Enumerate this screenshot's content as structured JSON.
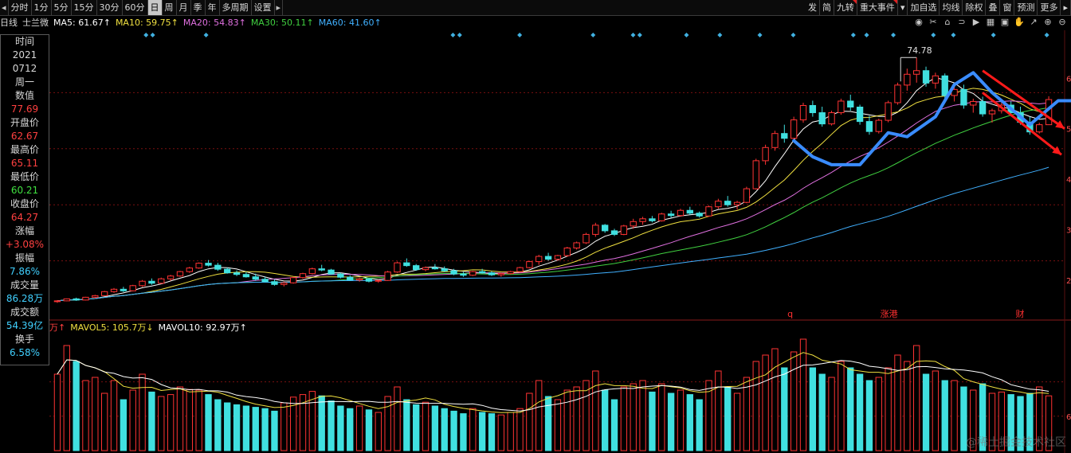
{
  "toolbar": {
    "left": [
      {
        "label": "分时",
        "name": "period-intraday",
        "active": false
      },
      {
        "label": "1分",
        "name": "period-1min",
        "active": false
      },
      {
        "label": "5分",
        "name": "period-5min",
        "active": false
      },
      {
        "label": "15分",
        "name": "period-15min",
        "active": false
      },
      {
        "label": "30分",
        "name": "period-30min",
        "active": false
      },
      {
        "label": "60分",
        "name": "period-60min",
        "active": false
      },
      {
        "label": "日",
        "name": "period-day",
        "active": true
      },
      {
        "label": "周",
        "name": "period-week",
        "active": false
      },
      {
        "label": "月",
        "name": "period-month",
        "active": false
      },
      {
        "label": "季",
        "name": "period-quarter",
        "active": false
      },
      {
        "label": "年",
        "name": "period-year",
        "active": false
      },
      {
        "label": "多周期",
        "name": "period-multi",
        "active": false
      },
      {
        "label": "设置",
        "name": "settings",
        "active": false
      }
    ],
    "right": [
      {
        "label": "发",
        "name": "btn-fa",
        "mark": false
      },
      {
        "label": "简",
        "name": "btn-jian",
        "mark": false
      },
      {
        "label": "九转",
        "name": "btn-jiuzhuan",
        "mark": true
      },
      {
        "label": "重大事件",
        "name": "btn-events",
        "mark": true
      },
      {
        "label": "▾",
        "name": "btn-events-dropdown",
        "mark": false
      },
      {
        "label": "加自选",
        "name": "btn-add-watchlist",
        "mark": false
      },
      {
        "label": "均线",
        "name": "btn-ma",
        "mark": false
      },
      {
        "label": "除权",
        "name": "btn-exright",
        "mark": false
      },
      {
        "label": "叠",
        "name": "btn-overlay",
        "mark": false
      },
      {
        "label": "窗",
        "name": "btn-window",
        "mark": false
      },
      {
        "label": "预测",
        "name": "btn-forecast",
        "mark": false
      },
      {
        "label": "更多",
        "name": "btn-more",
        "mark": false
      },
      {
        "label": "▸",
        "name": "btn-next",
        "mark": false
      }
    ],
    "left_arrow": "◂",
    "right_arrow": "▸"
  },
  "ma_legend": {
    "period": "日线",
    "name": "士兰微",
    "items": [
      {
        "label": "MA5: 61.67↑",
        "color": "#ffffff"
      },
      {
        "label": "MA10: 59.75↑",
        "color": "#f0e040"
      },
      {
        "label": "MA20: 54.83↑",
        "color": "#e070e0"
      },
      {
        "label": "MA30: 50.11↑",
        "color": "#40d040"
      },
      {
        "label": "MA60: 41.60↑",
        "color": "#40b0ff"
      }
    ]
  },
  "info_panel": {
    "rows": [
      {
        "label": "时间",
        "value": "2021",
        "color": "#d8d8d8"
      },
      {
        "label": "",
        "value": "0712",
        "color": "#d8d8d8"
      },
      {
        "label": "周一",
        "value": "",
        "color": "#d8d8d8"
      },
      {
        "label": "数值",
        "value": "77.69",
        "color": "#ff4040"
      },
      {
        "label": "开盘价",
        "value": "62.67",
        "color": "#ff4040"
      },
      {
        "label": "最高价",
        "value": "65.11",
        "color": "#ff4040"
      },
      {
        "label": "最低价",
        "value": "60.21",
        "color": "#40e040"
      },
      {
        "label": "收盘价",
        "value": "64.27",
        "color": "#ff4040"
      },
      {
        "label": "涨幅",
        "value": "+3.08%",
        "color": "#ff4040"
      },
      {
        "label": "振幅",
        "value": "7.86%",
        "color": "#40d0ff"
      },
      {
        "label": "成交量",
        "value": "86.28万",
        "color": "#40d0ff"
      },
      {
        "label": "成交额",
        "value": "54.39亿",
        "color": "#40d0ff"
      },
      {
        "label": "换手",
        "value": "6.58%",
        "color": "#40d0ff"
      }
    ]
  },
  "volume_legend": {
    "items": [
      {
        "label": "万↑",
        "color": "#ff4040"
      },
      {
        "label": "MAVOL5: 105.7万↓",
        "color": "#f0e040"
      },
      {
        "label": "MAVOL10: 92.97万↑",
        "color": "#ffffff"
      }
    ]
  },
  "annotations": {
    "high_label": "74.78",
    "event_q": "q",
    "event_2": "涨港",
    "event_3": "财"
  },
  "axis_ticks": [
    "6",
    "5",
    "4",
    "3",
    "2"
  ],
  "vol_axis_ticks": [
    "6"
  ],
  "icons": [
    "eye-icon",
    "scissors-icon",
    "brush-icon",
    "magnet-icon",
    "play-icon",
    "grid-icon",
    "fullscreen-icon",
    "hand-icon",
    "arrow-icon",
    "zoom-in-icon",
    "zoom-out-icon"
  ],
  "icon_glyphs": [
    "◉",
    "✂",
    "⌂",
    "⊃",
    "▶",
    "▦",
    "▣",
    "✋",
    "↗",
    "⊕",
    "⊖"
  ],
  "watermark": "@稀土掘金技术社区",
  "colors": {
    "up": "#ff3333",
    "down": "#40e0e0",
    "grid": "#7a1010",
    "blue_trend": "#3a8cff",
    "red_arrow": "#ff1a1a"
  },
  "chart_data": {
    "type": "candlestick",
    "title": "士兰微 日线",
    "price_ylim": [
      10,
      80
    ],
    "candles": [
      [
        13.8,
        14.2,
        13.5,
        14.0
      ],
      [
        14.0,
        14.6,
        13.9,
        14.5
      ],
      [
        14.5,
        14.8,
        14.0,
        14.2
      ],
      [
        14.2,
        15.0,
        14.1,
        14.9
      ],
      [
        14.9,
        15.5,
        14.6,
        15.3
      ],
      [
        15.3,
        16.5,
        15.2,
        16.3
      ],
      [
        16.3,
        17.2,
        16.0,
        16.9
      ],
      [
        16.9,
        17.5,
        16.2,
        16.5
      ],
      [
        16.5,
        18.0,
        16.4,
        17.8
      ],
      [
        17.8,
        19.2,
        17.5,
        18.9
      ],
      [
        18.9,
        19.6,
        18.0,
        18.4
      ],
      [
        18.4,
        19.8,
        18.2,
        19.5
      ],
      [
        19.5,
        20.5,
        19.0,
        20.2
      ],
      [
        20.2,
        21.5,
        20.0,
        21.3
      ],
      [
        21.3,
        22.5,
        21.0,
        22.2
      ],
      [
        22.2,
        23.6,
        22.0,
        23.4
      ],
      [
        23.4,
        24.2,
        22.6,
        22.9
      ],
      [
        22.9,
        23.5,
        21.5,
        21.9
      ],
      [
        21.9,
        22.3,
        20.8,
        21.0
      ],
      [
        21.0,
        21.6,
        20.2,
        20.6
      ],
      [
        20.6,
        21.2,
        19.8,
        20.0
      ],
      [
        20.0,
        20.8,
        19.0,
        19.4
      ],
      [
        19.4,
        20.0,
        18.6,
        18.8
      ],
      [
        18.8,
        19.4,
        17.8,
        18.1
      ],
      [
        18.1,
        18.8,
        17.6,
        18.5
      ],
      [
        18.5,
        20.0,
        18.3,
        19.8
      ],
      [
        19.8,
        21.0,
        19.5,
        20.8
      ],
      [
        20.8,
        22.3,
        20.6,
        22.0
      ],
      [
        22.0,
        23.0,
        21.4,
        21.7
      ],
      [
        21.7,
        22.0,
        20.5,
        20.7
      ],
      [
        20.7,
        21.0,
        19.6,
        19.9
      ],
      [
        19.9,
        20.4,
        19.0,
        19.2
      ],
      [
        19.2,
        19.8,
        18.8,
        19.5
      ],
      [
        19.5,
        19.7,
        18.6,
        18.9
      ],
      [
        18.9,
        19.3,
        18.5,
        19.1
      ],
      [
        19.1,
        21.5,
        19.0,
        21.2
      ],
      [
        21.2,
        23.8,
        21.0,
        23.5
      ],
      [
        23.5,
        24.6,
        22.5,
        22.8
      ],
      [
        22.8,
        23.2,
        21.5,
        21.8
      ],
      [
        21.8,
        22.6,
        21.4,
        22.3
      ],
      [
        22.3,
        23.2,
        21.8,
        22.0
      ],
      [
        22.0,
        22.6,
        21.2,
        21.5
      ],
      [
        21.5,
        22.0,
        20.4,
        20.7
      ],
      [
        20.7,
        21.2,
        20.0,
        20.4
      ],
      [
        20.4,
        21.5,
        20.2,
        21.3
      ],
      [
        21.3,
        22.0,
        20.8,
        21.0
      ],
      [
        21.0,
        21.4,
        20.2,
        20.5
      ],
      [
        20.5,
        21.0,
        20.0,
        20.8
      ],
      [
        20.8,
        21.5,
        20.6,
        21.3
      ],
      [
        21.3,
        22.5,
        21.1,
        22.3
      ],
      [
        22.3,
        24.0,
        22.1,
        23.8
      ],
      [
        23.8,
        25.5,
        23.0,
        25.1
      ],
      [
        25.1,
        26.0,
        24.0,
        24.4
      ],
      [
        24.4,
        25.5,
        24.0,
        25.3
      ],
      [
        25.3,
        27.5,
        25.0,
        27.2
      ],
      [
        27.2,
        28.8,
        26.8,
        28.5
      ],
      [
        28.5,
        31.0,
        28.2,
        30.6
      ],
      [
        30.6,
        33.5,
        30.0,
        32.9
      ],
      [
        32.9,
        33.2,
        31.0,
        31.5
      ],
      [
        31.5,
        32.0,
        30.2,
        30.6
      ],
      [
        30.6,
        33.0,
        30.4,
        32.7
      ],
      [
        32.7,
        34.5,
        32.0,
        33.8
      ],
      [
        33.8,
        35.0,
        33.0,
        34.5
      ],
      [
        34.5,
        35.2,
        33.6,
        34.0
      ],
      [
        34.0,
        36.0,
        33.8,
        35.7
      ],
      [
        35.7,
        36.5,
        34.8,
        35.3
      ],
      [
        35.3,
        37.0,
        35.0,
        36.6
      ],
      [
        36.6,
        37.5,
        35.5,
        35.9
      ],
      [
        35.9,
        36.3,
        34.8,
        35.2
      ],
      [
        35.2,
        37.8,
        35.0,
        37.5
      ],
      [
        37.5,
        39.5,
        37.0,
        38.9
      ],
      [
        38.9,
        40.2,
        37.5,
        38.0
      ],
      [
        38.0,
        39.0,
        36.8,
        38.6
      ],
      [
        38.6,
        42.5,
        38.4,
        42.0
      ],
      [
        42.0,
        49.5,
        41.8,
        49.0
      ],
      [
        49.0,
        53.0,
        48.0,
        52.3
      ],
      [
        52.3,
        56.5,
        51.5,
        55.8
      ],
      [
        55.8,
        58.0,
        53.5,
        54.6
      ],
      [
        54.6,
        60.0,
        54.2,
        59.2
      ],
      [
        59.2,
        63.5,
        58.5,
        62.8
      ],
      [
        62.8,
        64.0,
        60.0,
        61.0
      ],
      [
        61.0,
        62.5,
        57.5,
        58.2
      ],
      [
        58.2,
        61.5,
        57.8,
        61.0
      ],
      [
        61.0,
        64.5,
        60.5,
        63.9
      ],
      [
        63.9,
        65.5,
        61.5,
        62.4
      ],
      [
        62.4,
        63.0,
        58.0,
        58.8
      ],
      [
        58.8,
        60.2,
        55.5,
        56.3
      ],
      [
        56.3,
        59.5,
        55.8,
        59.1
      ],
      [
        59.1,
        64.0,
        58.6,
        63.5
      ],
      [
        63.5,
        68.5,
        63.0,
        67.9
      ],
      [
        67.9,
        72.0,
        66.5,
        70.6
      ],
      [
        70.6,
        74.78,
        68.5,
        71.5
      ],
      [
        71.5,
        72.5,
        67.5,
        68.4
      ],
      [
        68.4,
        71.0,
        67.0,
        70.2
      ],
      [
        70.2,
        70.8,
        64.5,
        65.3
      ],
      [
        65.3,
        67.5,
        63.8,
        66.8
      ],
      [
        66.8,
        68.0,
        62.0,
        62.9
      ],
      [
        62.9,
        64.5,
        61.0,
        63.8
      ],
      [
        63.8,
        65.0,
        60.0,
        60.7
      ],
      [
        60.7,
        62.0,
        58.5,
        61.5
      ],
      [
        61.5,
        63.5,
        60.8,
        62.9
      ],
      [
        62.9,
        63.8,
        60.5,
        61.0
      ],
      [
        61.0,
        62.5,
        58.0,
        58.6
      ],
      [
        58.6,
        60.0,
        55.5,
        56.2
      ],
      [
        56.2,
        58.5,
        55.8,
        58.0
      ],
      [
        58.0,
        65.11,
        58.0,
        64.27
      ]
    ],
    "volumes": [
      120,
      165,
      140,
      110,
      115,
      90,
      110,
      80,
      95,
      120,
      92,
      85,
      88,
      100,
      96,
      95,
      88,
      80,
      75,
      72,
      70,
      68,
      66,
      62,
      75,
      84,
      88,
      93,
      86,
      78,
      70,
      66,
      70,
      64,
      60,
      85,
      100,
      80,
      72,
      76,
      70,
      66,
      62,
      58,
      66,
      60,
      58,
      56,
      60,
      66,
      90,
      110,
      85,
      80,
      95,
      100,
      110,
      125,
      95,
      80,
      100,
      105,
      110,
      92,
      105,
      90,
      95,
      88,
      80,
      110,
      125,
      100,
      90,
      115,
      140,
      150,
      160,
      130,
      155,
      175,
      130,
      120,
      115,
      140,
      130,
      120,
      110,
      115,
      130,
      150,
      140,
      165,
      120,
      125,
      110,
      110,
      100,
      95,
      105,
      90,
      92,
      88,
      85,
      90,
      100,
      86
    ],
    "ma_names": [
      "MA5",
      "MA10",
      "MA20",
      "MA30",
      "MA60"
    ],
    "ma_values_last": [
      61.67,
      59.75,
      54.83,
      50.11,
      41.6
    ],
    "mavol5": 105.7,
    "mavol10": 92.97
  }
}
